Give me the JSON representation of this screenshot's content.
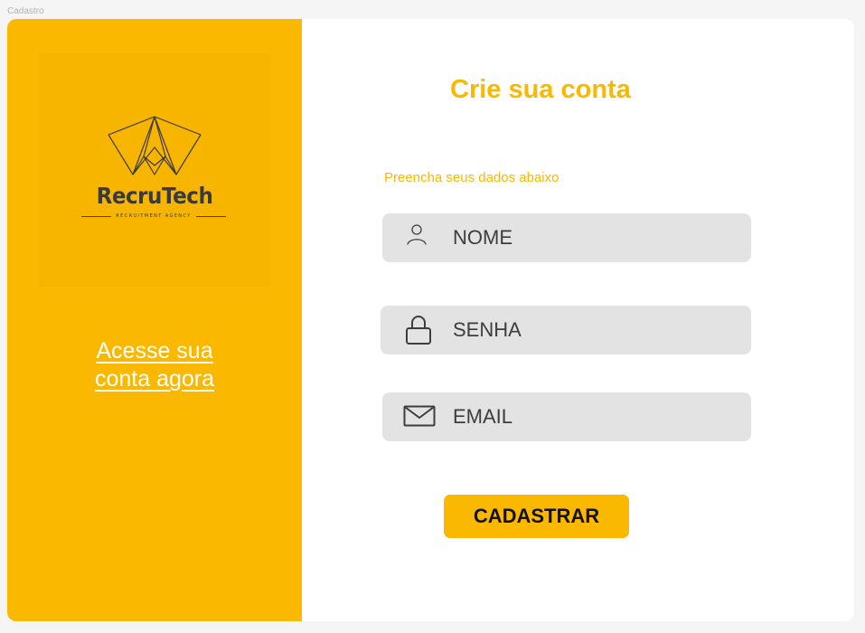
{
  "frame": {
    "label": "Cadastro"
  },
  "brand": {
    "name": "RecruTech",
    "tagline": "RECRUITMENT AGENCY",
    "logo_icon": "paper-boat-icon"
  },
  "login_link": {
    "line1": "Acesse sua",
    "line2": "conta agora"
  },
  "form": {
    "title": "Crie sua conta",
    "subtitle": "Preencha seus dados abaixo",
    "fields": [
      {
        "icon": "user-icon",
        "placeholder": "NOME",
        "value": ""
      },
      {
        "icon": "lock-icon",
        "placeholder": "SENHA",
        "value": ""
      },
      {
        "icon": "mail-icon",
        "placeholder": "EMAIL",
        "value": ""
      }
    ],
    "submit_label": "CADASTRAR"
  },
  "colors": {
    "accent": "#fbb800",
    "field_background": "#e3e3e3",
    "text_dark": "#333333",
    "link_text": "#ffffff"
  }
}
